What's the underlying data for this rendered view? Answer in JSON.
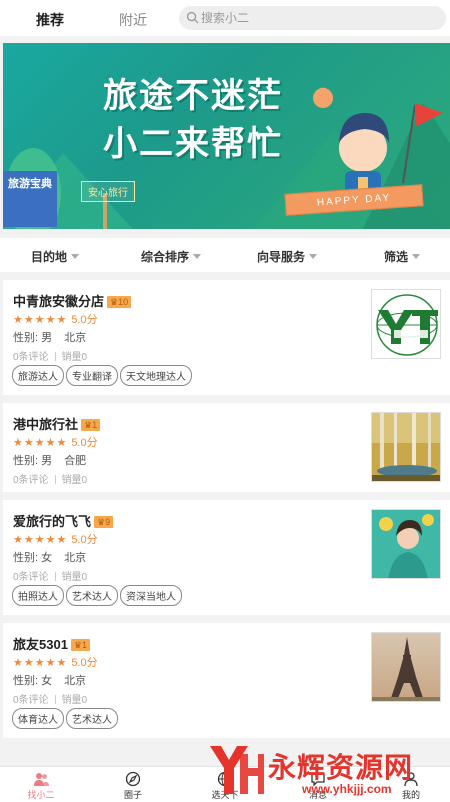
{
  "header": {
    "tabs": [
      {
        "label": "推荐",
        "active": true
      },
      {
        "label": "附近",
        "active": false
      }
    ],
    "search": {
      "placeholder": "搜索小二"
    }
  },
  "banner": {
    "line1": "旅途不迷茫",
    "line2": "小二来帮忙",
    "badge": "安心旅行",
    "book_label": "旅游宝典",
    "ribbon": "HAPPY DAY"
  },
  "filters": [
    {
      "label": "目的地"
    },
    {
      "label": "综合排序"
    },
    {
      "label": "向导服务"
    },
    {
      "label": "筛选"
    }
  ],
  "cards": [
    {
      "name": "中青旅安徽分店",
      "level": "10",
      "stars": 5,
      "score": "5.0分",
      "gender": "性别: 男",
      "city": "北京",
      "reviews": "0条评论",
      "sales": "销量0",
      "tags": [
        "旅游达人",
        "专业翻译",
        "天文地理达人"
      ],
      "thumb": "cyts-logo"
    },
    {
      "name": "港中旅行社",
      "level": "1",
      "stars": 5,
      "score": "5.0分",
      "gender": "性别: 男",
      "city": "合肥",
      "reviews": "0条评论",
      "sales": "销量0",
      "tags": [],
      "thumb": "forest-painting"
    },
    {
      "name": "爱旅行的飞飞",
      "level": "9",
      "stars": 5,
      "score": "5.0分",
      "gender": "性别: 女",
      "city": "北京",
      "reviews": "0条评论",
      "sales": "销量0",
      "tags": [
        "拍照达人",
        "艺术达人",
        "资深当地人"
      ],
      "thumb": "portrait-photo"
    },
    {
      "name": "旅友5301",
      "level": "1",
      "stars": 5,
      "score": "5.0分",
      "gender": "性别: 女",
      "city": "北京",
      "reviews": "0条评论",
      "sales": "销量0",
      "tags": [
        "体育达人",
        "艺术达人"
      ],
      "thumb": "eiffel-tower"
    }
  ],
  "bottom_nav": [
    {
      "label": "找小二",
      "icon": "people-icon",
      "active": true
    },
    {
      "label": "圈子",
      "icon": "compass-icon",
      "active": false
    },
    {
      "label": "选天下",
      "icon": "globe-icon",
      "active": false
    },
    {
      "label": "消息",
      "icon": "message-icon",
      "active": false
    },
    {
      "label": "我的",
      "icon": "user-icon",
      "active": false
    }
  ],
  "watermark": {
    "text": "永辉资源网",
    "url": "www.yhkjjj.com"
  },
  "colors": {
    "accent": "#f08a3a",
    "nav_active": "#f27a84",
    "banner_bg": "#1d9a8a"
  }
}
